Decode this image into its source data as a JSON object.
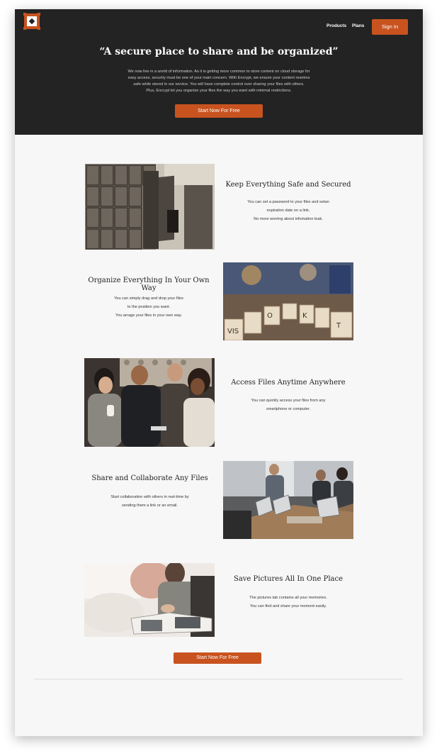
{
  "brand": {
    "accent": "#c8531f",
    "dark": "#232323",
    "logo": "encrypt-logo"
  },
  "nav": {
    "products": "Products",
    "plans": "Plans",
    "sign_in": "Sign In"
  },
  "hero": {
    "title": "“A secure place to share and be organized”",
    "lines": [
      "We now live in a world of information. As it is getting more common to store content on cloud storage for",
      "easy access, security must be one of your main concern. With Encrypt, we ensure your content reamins",
      "safe while stored in our service. You will have complete control over sharing your files with others.",
      "Plus, Encrypt let you organize your files the way you want with minimal restrictions."
    ],
    "cta": "Start Now For Free"
  },
  "features": [
    {
      "title": "Keep Everything Safe and Secured",
      "lines": [
        "You can set a password to your files and setan",
        "expiration date on a link.",
        "No more worring about infomation leak."
      ],
      "image": "lockers-photo"
    },
    {
      "title": "Organize Everything In Your Own Way",
      "lines": [
        "You can simply drag and drop your files",
        "to the position you want.",
        "You arrage your files in your own way."
      ],
      "image": "card-index-photo"
    },
    {
      "title": "Access Files Anytime Anywhere",
      "lines": [
        "You can quickly access your files from any",
        "smartphone or computer."
      ],
      "image": "group-phone-photo"
    },
    {
      "title": "Share and Collaborate Any Files",
      "lines": [
        "Start collaboration with others in real-time by",
        "sending them a link or an email."
      ],
      "image": "meeting-laptops-photo"
    },
    {
      "title": "Save Pictures All In One Place",
      "lines": [
        "The pictures tab contains all your memories.",
        "You can find and share your moment easily."
      ],
      "image": "photo-album-photo"
    }
  ],
  "footer_cta": "Start Now For Free"
}
